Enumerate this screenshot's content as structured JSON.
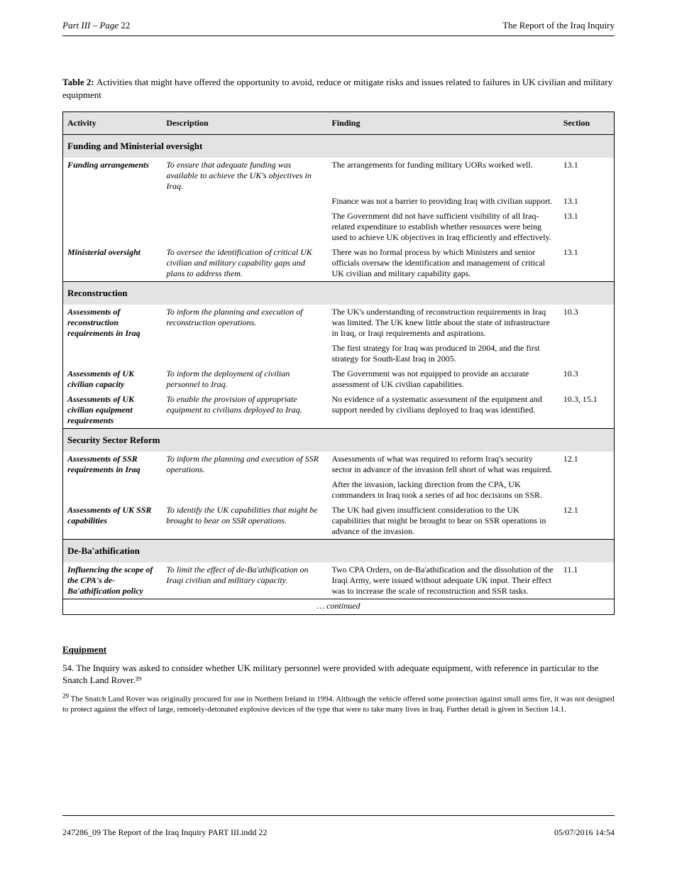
{
  "header": {
    "left_italic": "Part III – Page ",
    "left_page": "22",
    "right": "The Report of the Iraq Inquiry"
  },
  "title": {
    "label_bold": "Table 2: ",
    "label_rest": "Activities that might have offered the opportunity to avoid, reduce or mitigate risks and issues related to failures in UK civilian and military equipment"
  },
  "table": {
    "columns": [
      "Activity",
      "Description",
      "Finding",
      "Section"
    ],
    "groups": [
      {
        "category": "Funding and Ministerial oversight",
        "rows": [
          [
            "Funding arrangements",
            "To ensure that adequate funding was available to achieve the UK's objectives in Iraq.",
            "The arrangements for funding military UORs worked well.",
            "13.1"
          ],
          [
            "",
            "",
            "Finance was not a barrier to providing Iraq with civilian support.",
            "13.1"
          ],
          [
            "",
            "",
            "The Government did not have sufficient visibility of all Iraq-related expenditure to establish whether resources were being used to achieve UK objectives in Iraq efficiently and effectively.",
            "13.1"
          ],
          [
            "Ministerial oversight",
            "To oversee the identification of critical UK civilian and military capability gaps and plans to address them.",
            "There was no formal process by which Ministers and senior officials oversaw the identification and management of critical UK civilian and military capability gaps.",
            "13.1"
          ]
        ]
      },
      {
        "category": "Reconstruction",
        "rows": [
          [
            "Assessments of reconstruction requirements in Iraq",
            "To inform the planning and execution of reconstruction operations.",
            "The UK's understanding of reconstruction requirements in Iraq was limited. The UK knew little about the state of infrastructure in Iraq, or Iraqi requirements and aspirations.",
            "10.3"
          ],
          [
            "",
            "",
            "The first strategy for Iraq was produced in 2004, and the first strategy for South-East Iraq in 2005.",
            ""
          ],
          [
            "Assessments of UK civilian capacity",
            "To inform the deployment of civilian personnel to Iraq.",
            "The Government was not equipped to provide an accurate assessment of UK civilian capabilities.",
            "10.3"
          ],
          [
            "Assessments of UK civilian equipment requirements",
            "To enable the provision of appropriate equipment to civilians deployed to Iraq.",
            "No evidence of a systematic assessment of the equipment and support needed by civilians deployed to Iraq was identified.",
            "10.3, 15.1"
          ]
        ]
      },
      {
        "category": "Security Sector Reform",
        "rows": [
          [
            "Assessments of SSR requirements in Iraq",
            "To inform the planning and execution of SSR operations.",
            "Assessments of what was required to reform Iraq's security sector in advance of the invasion fell short of what was required.",
            "12.1"
          ],
          [
            "",
            "",
            "After the invasion, lacking direction from the CPA, UK commanders in Iraq took a series of ad hoc decisions on SSR.",
            ""
          ],
          [
            "Assessments of UK SSR capabilities",
            "To identify the UK capabilities that might be brought to bear on SSR operations.",
            "The UK had given insufficient consideration to the UK capabilities that might be brought to bear on SSR operations in advance of the invasion.",
            "12.1"
          ]
        ]
      },
      {
        "category": "De-Ba'athification",
        "rows": [
          [
            "Influencing the scope of the CPA's de-Ba'athification policy",
            "To limit the effect of de-Ba'athification on Iraqi civilian and military capacity.",
            "Two CPA Orders, on de-Ba'athification and the dissolution of the Iraqi Army, were issued without adequate UK input. Their effect was to increase the scale of reconstruction and SSR tasks.",
            "11.1"
          ]
        ]
      }
    ],
    "continued": "… continued"
  },
  "section": {
    "heading": "Equipment",
    "paragraphs": [
      "54.  The Inquiry was asked to consider whether UK military personnel were provided with ",
      "adequate equipment, with reference in particular to the Snatch Land Rover.²⁹"
    ]
  },
  "footnote": {
    "marker": "29",
    "text": "  The Snatch Land Rover was originally procured for use in Northern Ireland in 1994. Although the vehicle offered some protection against small arms fire, it was not designed to protect against the effect of large, remotely-detonated explosive devices of the type that were to take many lives in Iraq. Further detail is given in Section 14.1."
  },
  "footer": {
    "left": "247286_09 The Report of the Iraq Inquiry PART III.indd   22",
    "right": "05/07/2016   14:54"
  }
}
